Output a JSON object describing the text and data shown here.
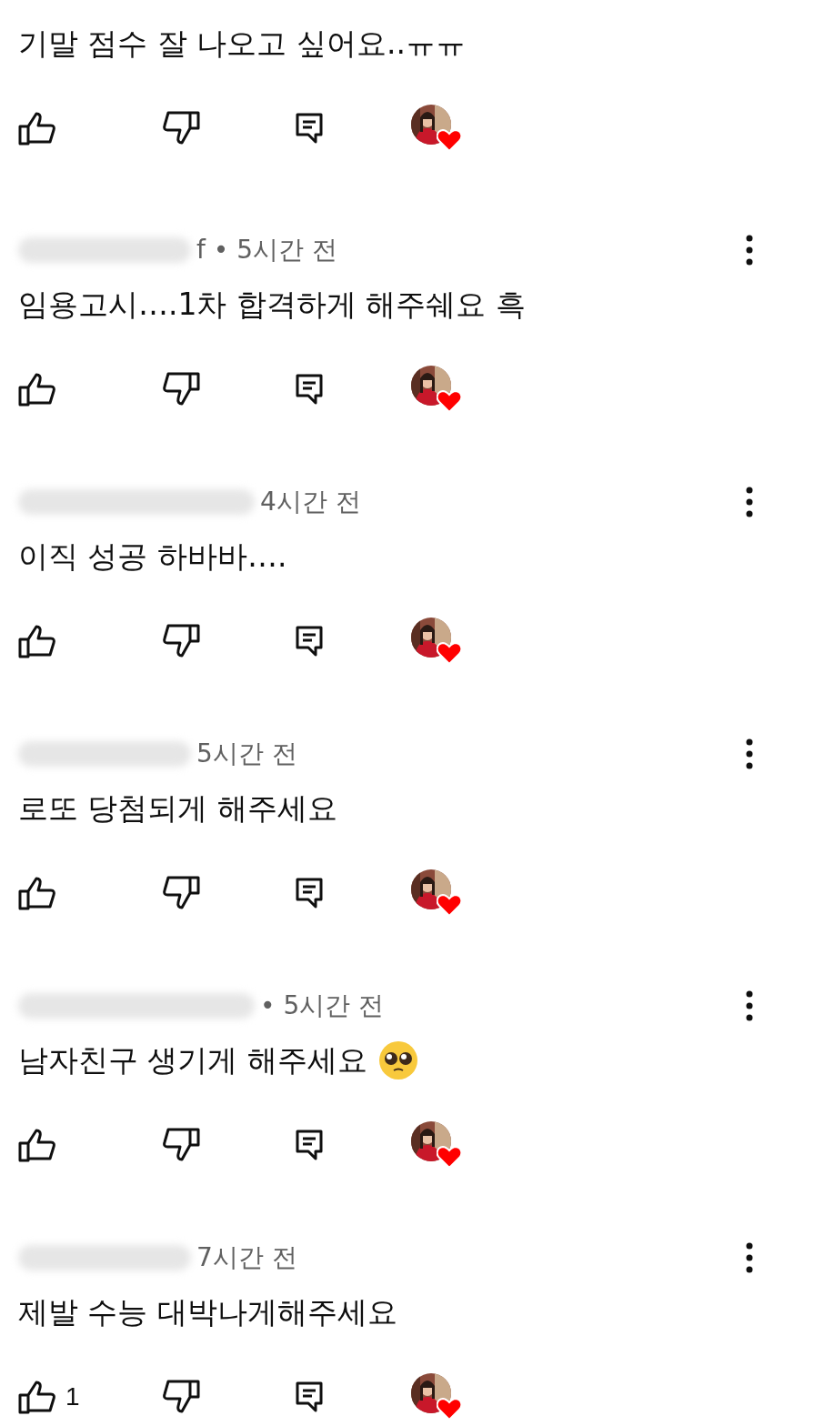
{
  "comments": [
    {
      "text": "기말 점수 잘 나오고 싶어요..ㅠㅠ",
      "hearted": true
    },
    {
      "meta": "f • 5시간 전",
      "text": "임용고시….1차 합격하게 해주쉐요 흑",
      "hearted": true
    },
    {
      "meta": "4시간 전",
      "text": "이직 성공 하바바….",
      "hearted": true
    },
    {
      "meta": "5시간 전",
      "text": "로또 당첨되게 해주세요",
      "hearted": true
    },
    {
      "meta": "• 5시간 전",
      "text": "남자친구 생기게 해주세요",
      "pleading_emoji": true,
      "hearted": true
    },
    {
      "meta": "7시간 전",
      "text": "제발 수능 대박나게해주세요",
      "likes": "1",
      "hearted": true
    }
  ]
}
